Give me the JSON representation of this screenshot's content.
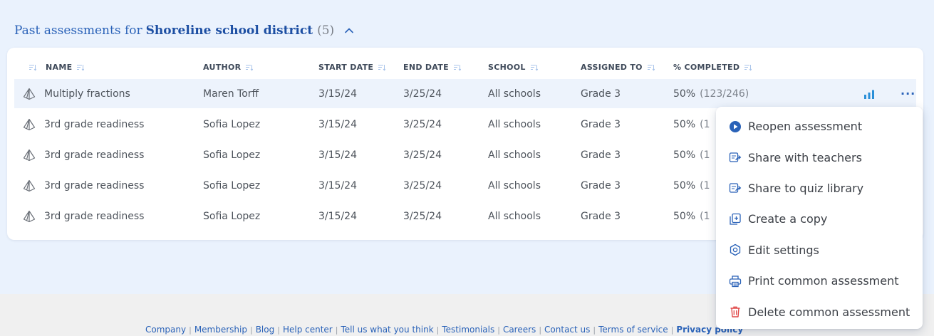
{
  "header": {
    "prefix": "Past assessments for",
    "district": "Shoreline school district",
    "count": "(5)"
  },
  "columns": [
    {
      "key": "name",
      "label": "NAME"
    },
    {
      "key": "author",
      "label": "AUTHOR"
    },
    {
      "key": "start",
      "label": "START DATE"
    },
    {
      "key": "end",
      "label": "END DATE"
    },
    {
      "key": "school",
      "label": "SCHOOL"
    },
    {
      "key": "assigned",
      "label": "ASSIGNED TO"
    },
    {
      "key": "pct",
      "label": "% COMPLETED"
    }
  ],
  "rows": [
    {
      "name": "Multiply fractions",
      "author": "Maren Torff",
      "start": "3/15/24",
      "end": "3/25/24",
      "school": "All schools",
      "assigned": "Grade 3",
      "pct": "50%",
      "pct_detail": "(123/246)"
    },
    {
      "name": "3rd grade readiness",
      "author": "Sofia Lopez",
      "start": "3/15/24",
      "end": "3/25/24",
      "school": "All schools",
      "assigned": "Grade 3",
      "pct": "50%",
      "pct_detail": "(1"
    },
    {
      "name": "3rd grade readiness",
      "author": "Sofia Lopez",
      "start": "3/15/24",
      "end": "3/25/24",
      "school": "All schools",
      "assigned": "Grade 3",
      "pct": "50%",
      "pct_detail": "(1"
    },
    {
      "name": "3rd grade readiness",
      "author": "Sofia Lopez",
      "start": "3/15/24",
      "end": "3/25/24",
      "school": "All schools",
      "assigned": "Grade 3",
      "pct": "50%",
      "pct_detail": "(1"
    },
    {
      "name": "3rd grade readiness",
      "author": "Sofia Lopez",
      "start": "3/15/24",
      "end": "3/25/24",
      "school": "All schools",
      "assigned": "Grade 3",
      "pct": "50%",
      "pct_detail": "(1"
    }
  ],
  "row_actions": {
    "chart_icon": "bar-chart-icon",
    "more_label": "···"
  },
  "menu": {
    "items": [
      {
        "label": "Reopen assessment",
        "icon": "play-circle-icon"
      },
      {
        "label": "Share with teachers",
        "icon": "share-icon"
      },
      {
        "label": "Share to quiz library",
        "icon": "share-icon"
      },
      {
        "label": "Create a copy",
        "icon": "copy-icon"
      },
      {
        "label": "Edit settings",
        "icon": "settings-icon"
      },
      {
        "label": "Print common assessment",
        "icon": "print-icon"
      },
      {
        "label": "Delete common assessment",
        "icon": "trash-icon"
      }
    ]
  },
  "footer": {
    "links": [
      "Company",
      "Membership",
      "Blog",
      "Help center",
      "Tell us what you think",
      "Testimonials",
      "Careers",
      "Contact us",
      "Terms of service",
      "Privacy policy"
    ]
  },
  "colors": {
    "page_bg": "#eaf2fd",
    "accent": "#2a62b8",
    "row_highlight": "#edf3fc",
    "delete_red": "#e04848"
  }
}
